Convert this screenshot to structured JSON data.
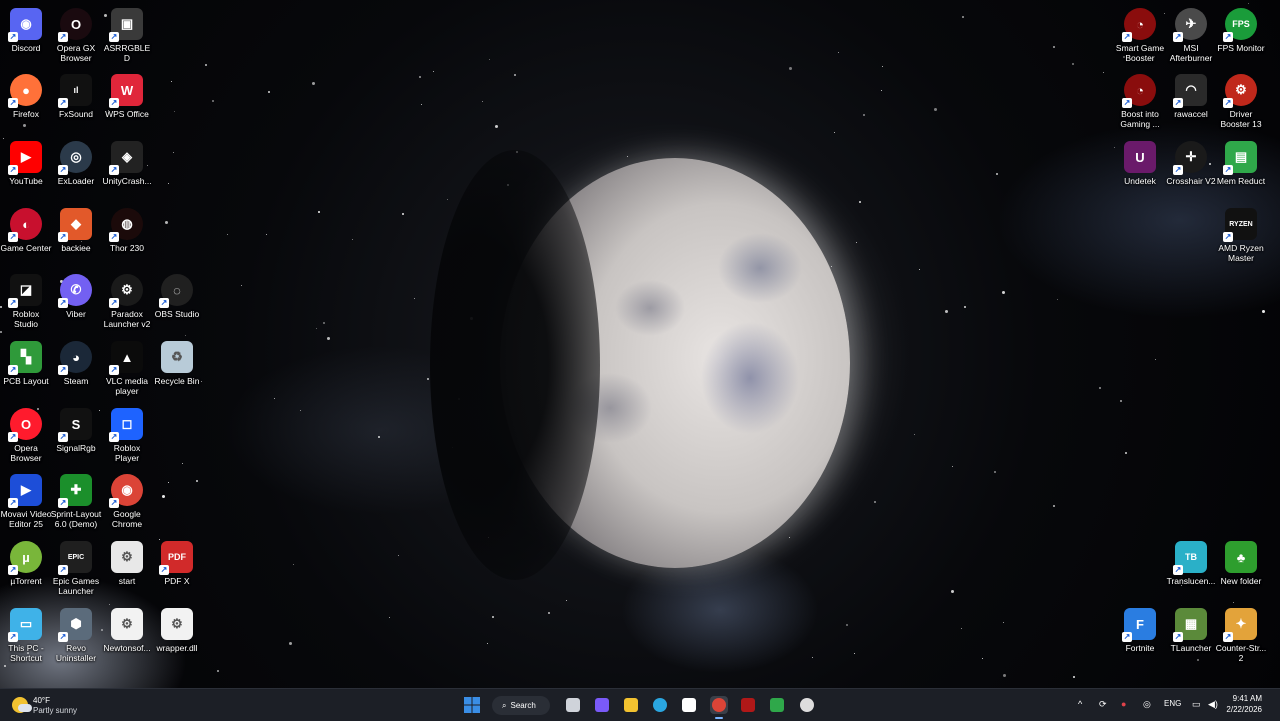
{
  "desktop": {
    "icons": [
      {
        "label": "Discord",
        "icon": "discord-icon",
        "color": "#5865F2",
        "glyph": "◉",
        "round": false,
        "shortcut": true
      },
      {
        "label": "Opera GX Browser",
        "icon": "opera-gx-icon",
        "color": "#1a0a0f",
        "glyph": "O",
        "round": true,
        "shortcut": true
      },
      {
        "label": "ASRRGBLED",
        "icon": "asrock-rgb-icon",
        "color": "#3a3a3a",
        "glyph": "▣",
        "round": false,
        "shortcut": true
      },
      {
        "label": "Firefox",
        "icon": "firefox-icon",
        "color": "#ff7139",
        "glyph": "●",
        "round": true,
        "shortcut": true
      },
      {
        "label": "FxSound",
        "icon": "fxsound-icon",
        "color": "#111111",
        "glyph": "ıl",
        "round": false,
        "shortcut": true
      },
      {
        "label": "WPS Office",
        "icon": "wps-office-icon",
        "color": "#e0263a",
        "glyph": "W",
        "round": false,
        "shortcut": true
      },
      {
        "label": "YouTube",
        "icon": "youtube-icon",
        "color": "#ff0000",
        "glyph": "▶",
        "round": false,
        "shortcut": true
      },
      {
        "label": "ExLoader",
        "icon": "exloader-icon",
        "color": "#2b3a4a",
        "glyph": "◎",
        "round": true,
        "shortcut": true
      },
      {
        "label": "UnityCrash...",
        "icon": "unity-icon",
        "color": "#222222",
        "glyph": "◈",
        "round": false,
        "shortcut": true
      },
      {
        "label": "Game Center",
        "icon": "game-center-icon",
        "color": "#c8102e",
        "glyph": "◐",
        "round": true,
        "shortcut": true
      },
      {
        "label": "backiee",
        "icon": "backiee-icon",
        "color": "#e2592a",
        "glyph": "◆",
        "round": false,
        "shortcut": true
      },
      {
        "label": "Thor 230",
        "icon": "thor-icon",
        "color": "#1b0a0a",
        "glyph": "◍",
        "round": true,
        "shortcut": true
      },
      {
        "label": "Roblox Studio",
        "icon": "roblox-studio-icon",
        "color": "#111111",
        "glyph": "◪",
        "round": false,
        "shortcut": true
      },
      {
        "label": "Viber",
        "icon": "viber-icon",
        "color": "#7360f2",
        "glyph": "✆",
        "round": true,
        "shortcut": true
      },
      {
        "label": "Paradox Launcher v2",
        "icon": "paradox-icon",
        "color": "#1a1a1a",
        "glyph": "⚙",
        "round": true,
        "shortcut": true
      },
      {
        "label": "OBS Studio",
        "icon": "obs-icon",
        "color": "#202020",
        "glyph": "◌",
        "round": true,
        "shortcut": true
      },
      {
        "label": "PCB Layout",
        "icon": "pcb-layout-icon",
        "color": "#2f9a3a",
        "glyph": "▚",
        "round": false,
        "shortcut": true
      },
      {
        "label": "Steam",
        "icon": "steam-icon",
        "color": "#1b2838",
        "glyph": "◕",
        "round": true,
        "shortcut": true
      },
      {
        "label": "VLC media player",
        "icon": "vlc-icon",
        "color": "#0b0b0b",
        "glyph": "▲",
        "round": false,
        "shortcut": true
      },
      {
        "label": "Recycle Bin",
        "icon": "recycle-bin-icon",
        "color": "#b8cbd8",
        "glyph": "♻",
        "round": false,
        "shortcut": false
      },
      {
        "label": "Opera Browser",
        "icon": "opera-icon",
        "color": "#ff1b2d",
        "glyph": "O",
        "round": true,
        "shortcut": true
      },
      {
        "label": "SignalRgb",
        "icon": "signalrgb-icon",
        "color": "#111111",
        "glyph": "S",
        "round": false,
        "shortcut": true
      },
      {
        "label": "Roblox Player",
        "icon": "roblox-player-icon",
        "color": "#1e63ff",
        "glyph": "◻",
        "round": false,
        "shortcut": true
      },
      {
        "label": "Movavi Video Editor 25",
        "icon": "movavi-icon",
        "color": "#1d4ed8",
        "glyph": "▶",
        "round": false,
        "shortcut": true
      },
      {
        "label": "Sprint-Layout 6.0 (Demo)",
        "icon": "sprint-layout-icon",
        "color": "#1b8f2b",
        "glyph": "✚",
        "round": false,
        "shortcut": true
      },
      {
        "label": "Google Chrome",
        "icon": "chrome-icon",
        "color": "#db4437",
        "glyph": "◉",
        "round": true,
        "shortcut": true
      },
      {
        "label": "µTorrent",
        "icon": "utorrent-icon",
        "color": "#79b63a",
        "glyph": "µ",
        "round": true,
        "shortcut": true
      },
      {
        "label": "Epic Games Launcher",
        "icon": "epic-games-icon",
        "color": "#1f1f1f",
        "glyph": "EPIC",
        "round": false,
        "shortcut": true
      },
      {
        "label": "start",
        "icon": "batch-file-icon",
        "color": "#e8e8e8",
        "glyph": "⚙",
        "round": false,
        "shortcut": false
      },
      {
        "label": "PDF X",
        "icon": "pdf-x-icon",
        "color": "#d12a2a",
        "glyph": "PDF",
        "round": false,
        "shortcut": true
      },
      {
        "label": "This PC - Shortcut",
        "icon": "this-pc-icon",
        "color": "#3fb2e8",
        "glyph": "▭",
        "round": false,
        "shortcut": true
      },
      {
        "label": "Revo Uninstaller",
        "icon": "revo-uninstaller-icon",
        "color": "#5b6b7b",
        "glyph": "⬢",
        "round": false,
        "shortcut": true
      },
      {
        "label": "Newtonsof...",
        "icon": "dll-file-icon",
        "color": "#f2f2f2",
        "glyph": "⚙",
        "round": false,
        "shortcut": false
      },
      {
        "label": "wrapper.dll",
        "icon": "dll-file-icon",
        "color": "#f2f2f2",
        "glyph": "⚙",
        "round": false,
        "shortcut": false
      },
      {
        "label": "Smart Game Booster",
        "icon": "smart-game-booster-icon",
        "color": "#8a0d0d",
        "glyph": "◔",
        "round": true,
        "shortcut": true
      },
      {
        "label": "MSI Afterburner",
        "icon": "msi-afterburner-icon",
        "color": "#4a4a4a",
        "glyph": "✈",
        "round": true,
        "shortcut": true
      },
      {
        "label": "FPS Monitor",
        "icon": "fps-monitor-icon",
        "color": "#1a9c3a",
        "glyph": "FPS",
        "round": true,
        "shortcut": true
      },
      {
        "label": "Boost into Gaming ...",
        "icon": "boost-gaming-icon",
        "color": "#8a0d0d",
        "glyph": "◔",
        "round": true,
        "shortcut": true
      },
      {
        "label": "rawaccel",
        "icon": "rawaccel-icon",
        "color": "#2a2a2a",
        "glyph": "◠",
        "round": false,
        "shortcut": true
      },
      {
        "label": "Driver Booster 13",
        "icon": "driver-booster-icon",
        "color": "#c0281b",
        "glyph": "⚙",
        "round": true,
        "shortcut": true
      },
      {
        "label": "Undetek",
        "icon": "undetek-icon",
        "color": "#6a1a6a",
        "glyph": "U",
        "round": false,
        "shortcut": false
      },
      {
        "label": "Crosshair V2",
        "icon": "crosshair-icon",
        "color": "#1a1a1a",
        "glyph": "✛",
        "round": true,
        "shortcut": true
      },
      {
        "label": "Mem Reduct",
        "icon": "mem-reduct-icon",
        "color": "#2fa84a",
        "glyph": "▤",
        "round": false,
        "shortcut": true
      },
      {
        "label": "AMD Ryzen Master",
        "icon": "amd-ryzen-master-icon",
        "color": "#111111",
        "glyph": "RYZEN",
        "round": false,
        "shortcut": true
      },
      {
        "label": "Translucen...",
        "icon": "translucenttb-icon",
        "color": "#2ab0c8",
        "glyph": "TB",
        "round": false,
        "shortcut": true
      },
      {
        "label": "New folder",
        "icon": "tree-folder-icon",
        "color": "#2e9e2e",
        "glyph": "♣",
        "round": false,
        "shortcut": false
      },
      {
        "label": "Fortnite",
        "icon": "fortnite-icon",
        "color": "#2a7de1",
        "glyph": "F",
        "round": false,
        "shortcut": true
      },
      {
        "label": "TLauncher",
        "icon": "tlauncher-icon",
        "color": "#5b8a3a",
        "glyph": "▦",
        "round": false,
        "shortcut": true
      },
      {
        "label": "Counter-Str... 2",
        "icon": "counter-strike-icon",
        "color": "#e3a33a",
        "glyph": "✦",
        "round": false,
        "shortcut": true
      }
    ]
  },
  "taskbar": {
    "weather": {
      "temp": "40°F",
      "condition": "Partly sunny"
    },
    "search_label": "Search",
    "pinned": [
      {
        "icon": "windows-start-icon",
        "color": "#3a8ee6"
      },
      {
        "icon": "task-view-icon",
        "color": "#cfd3da"
      },
      {
        "icon": "copilot-icon",
        "color": "#7a5af8"
      },
      {
        "icon": "file-explorer-icon",
        "color": "#f2c230"
      },
      {
        "icon": "edge-icon",
        "color": "#2aa6e0"
      },
      {
        "icon": "microsoft-store-icon",
        "color": "#ffffff"
      },
      {
        "icon": "chrome-icon",
        "color": "#db4437"
      },
      {
        "icon": "smart-game-booster-icon",
        "color": "#b01818"
      },
      {
        "icon": "mem-reduct-icon",
        "color": "#2fa84a"
      },
      {
        "icon": "crosshair-icon",
        "color": "#dddddd"
      }
    ],
    "tray": {
      "language": "ENG",
      "time": "9:41 AM",
      "date": "2/22/2026"
    }
  }
}
